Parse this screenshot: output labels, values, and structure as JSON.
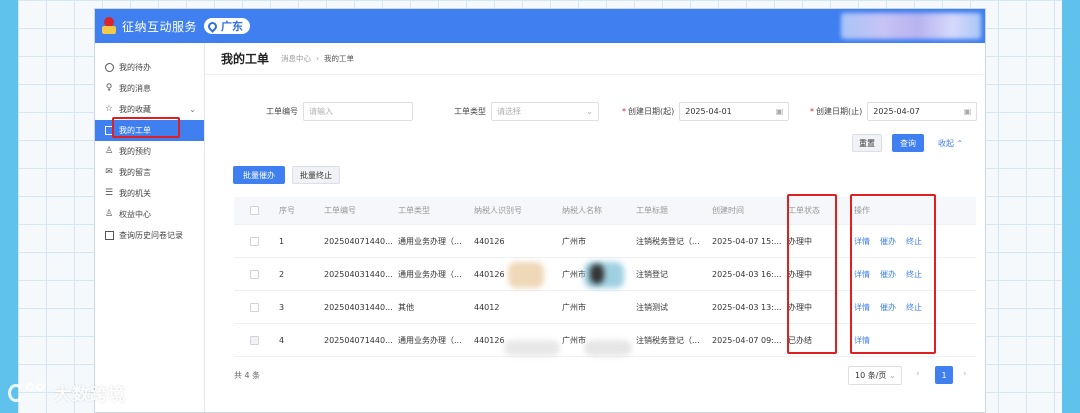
{
  "header": {
    "app_title": "征纳互动服务",
    "region": "广东"
  },
  "sidebar": {
    "items": [
      {
        "label": "我的待办",
        "icon": "clock-icon"
      },
      {
        "label": "我的消息",
        "icon": "bulb-icon"
      },
      {
        "label": "我的收藏",
        "icon": "star-icon"
      },
      {
        "label": "我的工单",
        "icon": "document-icon"
      },
      {
        "label": "我的预约",
        "icon": "user-icon"
      },
      {
        "label": "我的留言",
        "icon": "mail-icon"
      },
      {
        "label": "我的机关",
        "icon": "building-icon"
      },
      {
        "label": "权益中心",
        "icon": "user-icon"
      },
      {
        "label": "查询历史问卷记录",
        "icon": "document-icon"
      }
    ]
  },
  "page": {
    "title": "我的工单",
    "breadcrumb": [
      "消息中心",
      "我的工单"
    ]
  },
  "filters": {
    "ticket_no": {
      "label": "工单编号",
      "placeholder": "请输入"
    },
    "ticket_type": {
      "label": "工单类型",
      "placeholder": "请选择"
    },
    "created_start": {
      "label": "创建日期(起)",
      "value": "2025-04-01"
    },
    "created_end": {
      "label": "创建日期(止)",
      "value": "2025-04-07"
    }
  },
  "actions": {
    "reset": "重置",
    "query": "查询",
    "collapse": "收起",
    "batch_urge": "批量催办",
    "batch_stop": "批量终止"
  },
  "table": {
    "columns": [
      "序号",
      "工单编号",
      "工单类型",
      "纳税人识别号",
      "纳税人名称",
      "工单标题",
      "创建时间",
      "工单状态",
      "操作"
    ],
    "rows": [
      {
        "idx": "1",
        "no": "202504071440...",
        "type": "通用业务办理（...",
        "tin": "440126",
        "name": "广州市",
        "title": "注销税务登记（...",
        "time": "2025-04-07 15:...",
        "status": "办理中",
        "ops": [
          "详情",
          "催办",
          "终止"
        ]
      },
      {
        "idx": "2",
        "no": "202504031440...",
        "type": "通用业务办理（...",
        "tin": "440126",
        "name": "广州市",
        "title": "注销登记",
        "time": "2025-04-03 16:...",
        "status": "办理中",
        "ops": [
          "详情",
          "催办",
          "终止"
        ]
      },
      {
        "idx": "3",
        "no": "202504031440...",
        "type": "其他",
        "tin": "44012",
        "name": "广州市",
        "title": "注销测试",
        "time": "2025-04-03 13:...",
        "status": "办理中",
        "ops": [
          "详情",
          "催办",
          "终止"
        ]
      },
      {
        "idx": "4",
        "no": "202504071440...",
        "type": "通用业务办理（...",
        "tin": "440126",
        "name": "广州市",
        "title": "注销税务登记（...",
        "time": "2025-04-07 09:...",
        "status": "已办结",
        "ops": [
          "详情"
        ]
      }
    ]
  },
  "pagination": {
    "total": "共 4 条",
    "page_size": "10 条/页",
    "current": "1"
  },
  "watermark": {
    "text": "大数跨境"
  },
  "colors": {
    "primary": "#3f7ff0",
    "highlight": "#e02020",
    "background": "#5ec2ec"
  }
}
